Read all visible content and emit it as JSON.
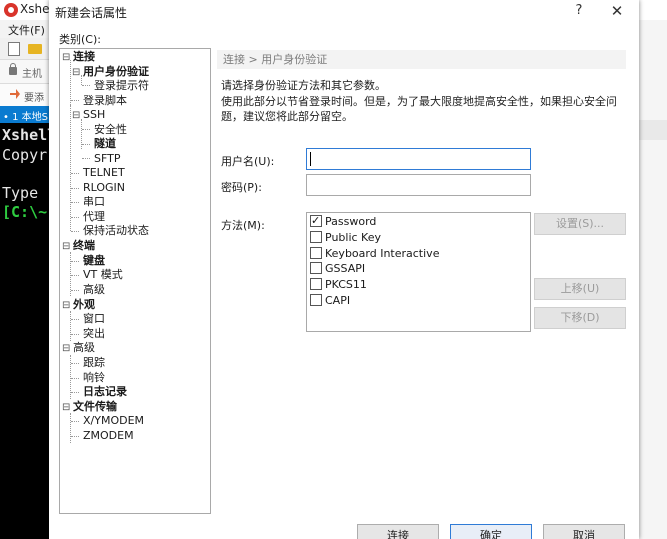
{
  "app": {
    "title": "Xshell",
    "menu_file": "文件(F)",
    "addr_text": "主机",
    "hint_text": "要添",
    "tab_label": "• 1 本地S",
    "terminal_lines": [
      "Xshell",
      "Copyr",
      "Type",
      "[C:\\~"
    ]
  },
  "dialog": {
    "title": "新建会话属性",
    "help_label": "?",
    "close_label": "✕",
    "category_label": "类别(C):",
    "tree": [
      {
        "label": "连接",
        "toggle": "⊟",
        "bold": true
      },
      {
        "label": "用户身份验证",
        "toggle": "⊟",
        "bold": true,
        "selected": true
      },
      {
        "label": "登录提示符",
        "toggle": "",
        "bold": false
      },
      {
        "label": "登录脚本",
        "toggle": "",
        "bold": false
      },
      {
        "label": "SSH",
        "toggle": "⊟",
        "bold": false
      },
      {
        "label": "安全性",
        "toggle": "",
        "bold": false
      },
      {
        "label": "隧道",
        "toggle": "",
        "bold": true
      },
      {
        "label": "SFTP",
        "toggle": "",
        "bold": false
      },
      {
        "label": "TELNET",
        "toggle": "",
        "bold": false
      },
      {
        "label": "RLOGIN",
        "toggle": "",
        "bold": false
      },
      {
        "label": "串口",
        "toggle": "",
        "bold": false
      },
      {
        "label": "代理",
        "toggle": "",
        "bold": false
      },
      {
        "label": "保持活动状态",
        "toggle": "",
        "bold": false
      },
      {
        "label": "终端",
        "toggle": "⊟",
        "bold": true
      },
      {
        "label": "键盘",
        "toggle": "",
        "bold": true
      },
      {
        "label": "VT 模式",
        "toggle": "",
        "bold": false
      },
      {
        "label": "高级",
        "toggle": "",
        "bold": false
      },
      {
        "label": "外观",
        "toggle": "⊟",
        "bold": true
      },
      {
        "label": "窗口",
        "toggle": "",
        "bold": false
      },
      {
        "label": "突出",
        "toggle": "",
        "bold": false
      },
      {
        "label": "高级",
        "toggle": "⊟",
        "bold": false
      },
      {
        "label": "跟踪",
        "toggle": "",
        "bold": false
      },
      {
        "label": "响铃",
        "toggle": "",
        "bold": false
      },
      {
        "label": "日志记录",
        "toggle": "",
        "bold": true
      },
      {
        "label": "文件传输",
        "toggle": "⊟",
        "bold": true
      },
      {
        "label": "X/YMODEM",
        "toggle": "",
        "bold": false
      },
      {
        "label": "ZMODEM",
        "toggle": "",
        "bold": false
      }
    ],
    "breadcrumb": "连接 > 用户身份验证",
    "instruction": "请选择身份验证方法和其它参数。",
    "description": "使用此部分以节省登录时间。但是，为了最大限度地提高安全性，如果担心安全问题，建议您将此部分留空。",
    "username_label": "用户名(U):",
    "username_value": "",
    "password_label": "密码(P):",
    "password_value": "",
    "method_label": "方法(M):",
    "methods": [
      {
        "label": "Password",
        "checked": true
      },
      {
        "label": "Public Key",
        "checked": false
      },
      {
        "label": "Keyboard Interactive",
        "checked": false
      },
      {
        "label": "GSSAPI",
        "checked": false
      },
      {
        "label": "PKCS11",
        "checked": false
      },
      {
        "label": "CAPI",
        "checked": false
      }
    ],
    "settings_button": "设置(S)...",
    "move_up_button": "上移(U)",
    "move_down_button": "下移(D)",
    "connect_button": "连接",
    "ok_button": "确定",
    "cancel_button": "取消"
  }
}
